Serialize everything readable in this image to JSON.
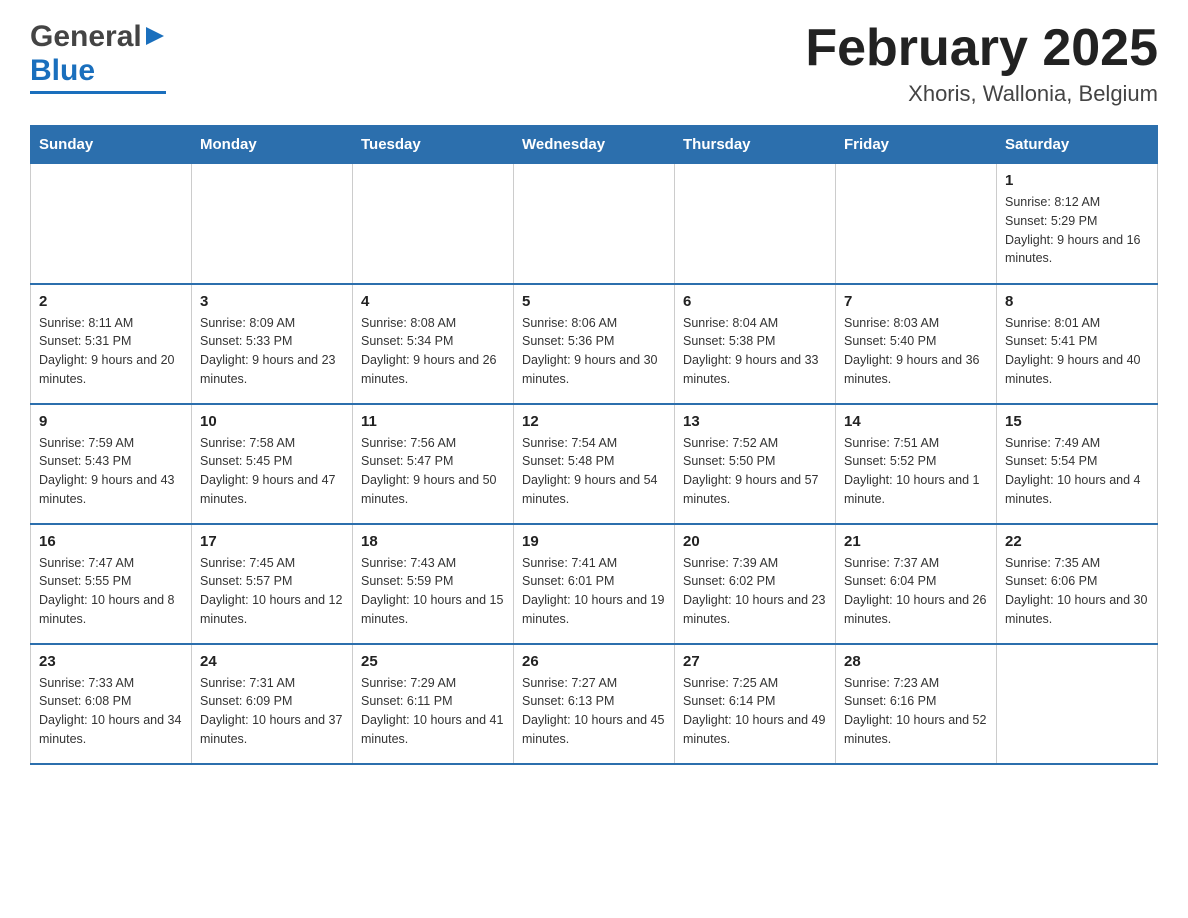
{
  "header": {
    "logo": {
      "line1": "General",
      "arrow": "▶",
      "line2": "Blue"
    },
    "title": "February 2025",
    "subtitle": "Xhoris, Wallonia, Belgium"
  },
  "days_of_week": [
    "Sunday",
    "Monday",
    "Tuesday",
    "Wednesday",
    "Thursday",
    "Friday",
    "Saturday"
  ],
  "weeks": [
    [
      {
        "day": "",
        "info": ""
      },
      {
        "day": "",
        "info": ""
      },
      {
        "day": "",
        "info": ""
      },
      {
        "day": "",
        "info": ""
      },
      {
        "day": "",
        "info": ""
      },
      {
        "day": "",
        "info": ""
      },
      {
        "day": "1",
        "info": "Sunrise: 8:12 AM\nSunset: 5:29 PM\nDaylight: 9 hours and 16 minutes."
      }
    ],
    [
      {
        "day": "2",
        "info": "Sunrise: 8:11 AM\nSunset: 5:31 PM\nDaylight: 9 hours and 20 minutes."
      },
      {
        "day": "3",
        "info": "Sunrise: 8:09 AM\nSunset: 5:33 PM\nDaylight: 9 hours and 23 minutes."
      },
      {
        "day": "4",
        "info": "Sunrise: 8:08 AM\nSunset: 5:34 PM\nDaylight: 9 hours and 26 minutes."
      },
      {
        "day": "5",
        "info": "Sunrise: 8:06 AM\nSunset: 5:36 PM\nDaylight: 9 hours and 30 minutes."
      },
      {
        "day": "6",
        "info": "Sunrise: 8:04 AM\nSunset: 5:38 PM\nDaylight: 9 hours and 33 minutes."
      },
      {
        "day": "7",
        "info": "Sunrise: 8:03 AM\nSunset: 5:40 PM\nDaylight: 9 hours and 36 minutes."
      },
      {
        "day": "8",
        "info": "Sunrise: 8:01 AM\nSunset: 5:41 PM\nDaylight: 9 hours and 40 minutes."
      }
    ],
    [
      {
        "day": "9",
        "info": "Sunrise: 7:59 AM\nSunset: 5:43 PM\nDaylight: 9 hours and 43 minutes."
      },
      {
        "day": "10",
        "info": "Sunrise: 7:58 AM\nSunset: 5:45 PM\nDaylight: 9 hours and 47 minutes."
      },
      {
        "day": "11",
        "info": "Sunrise: 7:56 AM\nSunset: 5:47 PM\nDaylight: 9 hours and 50 minutes."
      },
      {
        "day": "12",
        "info": "Sunrise: 7:54 AM\nSunset: 5:48 PM\nDaylight: 9 hours and 54 minutes."
      },
      {
        "day": "13",
        "info": "Sunrise: 7:52 AM\nSunset: 5:50 PM\nDaylight: 9 hours and 57 minutes."
      },
      {
        "day": "14",
        "info": "Sunrise: 7:51 AM\nSunset: 5:52 PM\nDaylight: 10 hours and 1 minute."
      },
      {
        "day": "15",
        "info": "Sunrise: 7:49 AM\nSunset: 5:54 PM\nDaylight: 10 hours and 4 minutes."
      }
    ],
    [
      {
        "day": "16",
        "info": "Sunrise: 7:47 AM\nSunset: 5:55 PM\nDaylight: 10 hours and 8 minutes."
      },
      {
        "day": "17",
        "info": "Sunrise: 7:45 AM\nSunset: 5:57 PM\nDaylight: 10 hours and 12 minutes."
      },
      {
        "day": "18",
        "info": "Sunrise: 7:43 AM\nSunset: 5:59 PM\nDaylight: 10 hours and 15 minutes."
      },
      {
        "day": "19",
        "info": "Sunrise: 7:41 AM\nSunset: 6:01 PM\nDaylight: 10 hours and 19 minutes."
      },
      {
        "day": "20",
        "info": "Sunrise: 7:39 AM\nSunset: 6:02 PM\nDaylight: 10 hours and 23 minutes."
      },
      {
        "day": "21",
        "info": "Sunrise: 7:37 AM\nSunset: 6:04 PM\nDaylight: 10 hours and 26 minutes."
      },
      {
        "day": "22",
        "info": "Sunrise: 7:35 AM\nSunset: 6:06 PM\nDaylight: 10 hours and 30 minutes."
      }
    ],
    [
      {
        "day": "23",
        "info": "Sunrise: 7:33 AM\nSunset: 6:08 PM\nDaylight: 10 hours and 34 minutes."
      },
      {
        "day": "24",
        "info": "Sunrise: 7:31 AM\nSunset: 6:09 PM\nDaylight: 10 hours and 37 minutes."
      },
      {
        "day": "25",
        "info": "Sunrise: 7:29 AM\nSunset: 6:11 PM\nDaylight: 10 hours and 41 minutes."
      },
      {
        "day": "26",
        "info": "Sunrise: 7:27 AM\nSunset: 6:13 PM\nDaylight: 10 hours and 45 minutes."
      },
      {
        "day": "27",
        "info": "Sunrise: 7:25 AM\nSunset: 6:14 PM\nDaylight: 10 hours and 49 minutes."
      },
      {
        "day": "28",
        "info": "Sunrise: 7:23 AM\nSunset: 6:16 PM\nDaylight: 10 hours and 52 minutes."
      },
      {
        "day": "",
        "info": ""
      }
    ]
  ]
}
